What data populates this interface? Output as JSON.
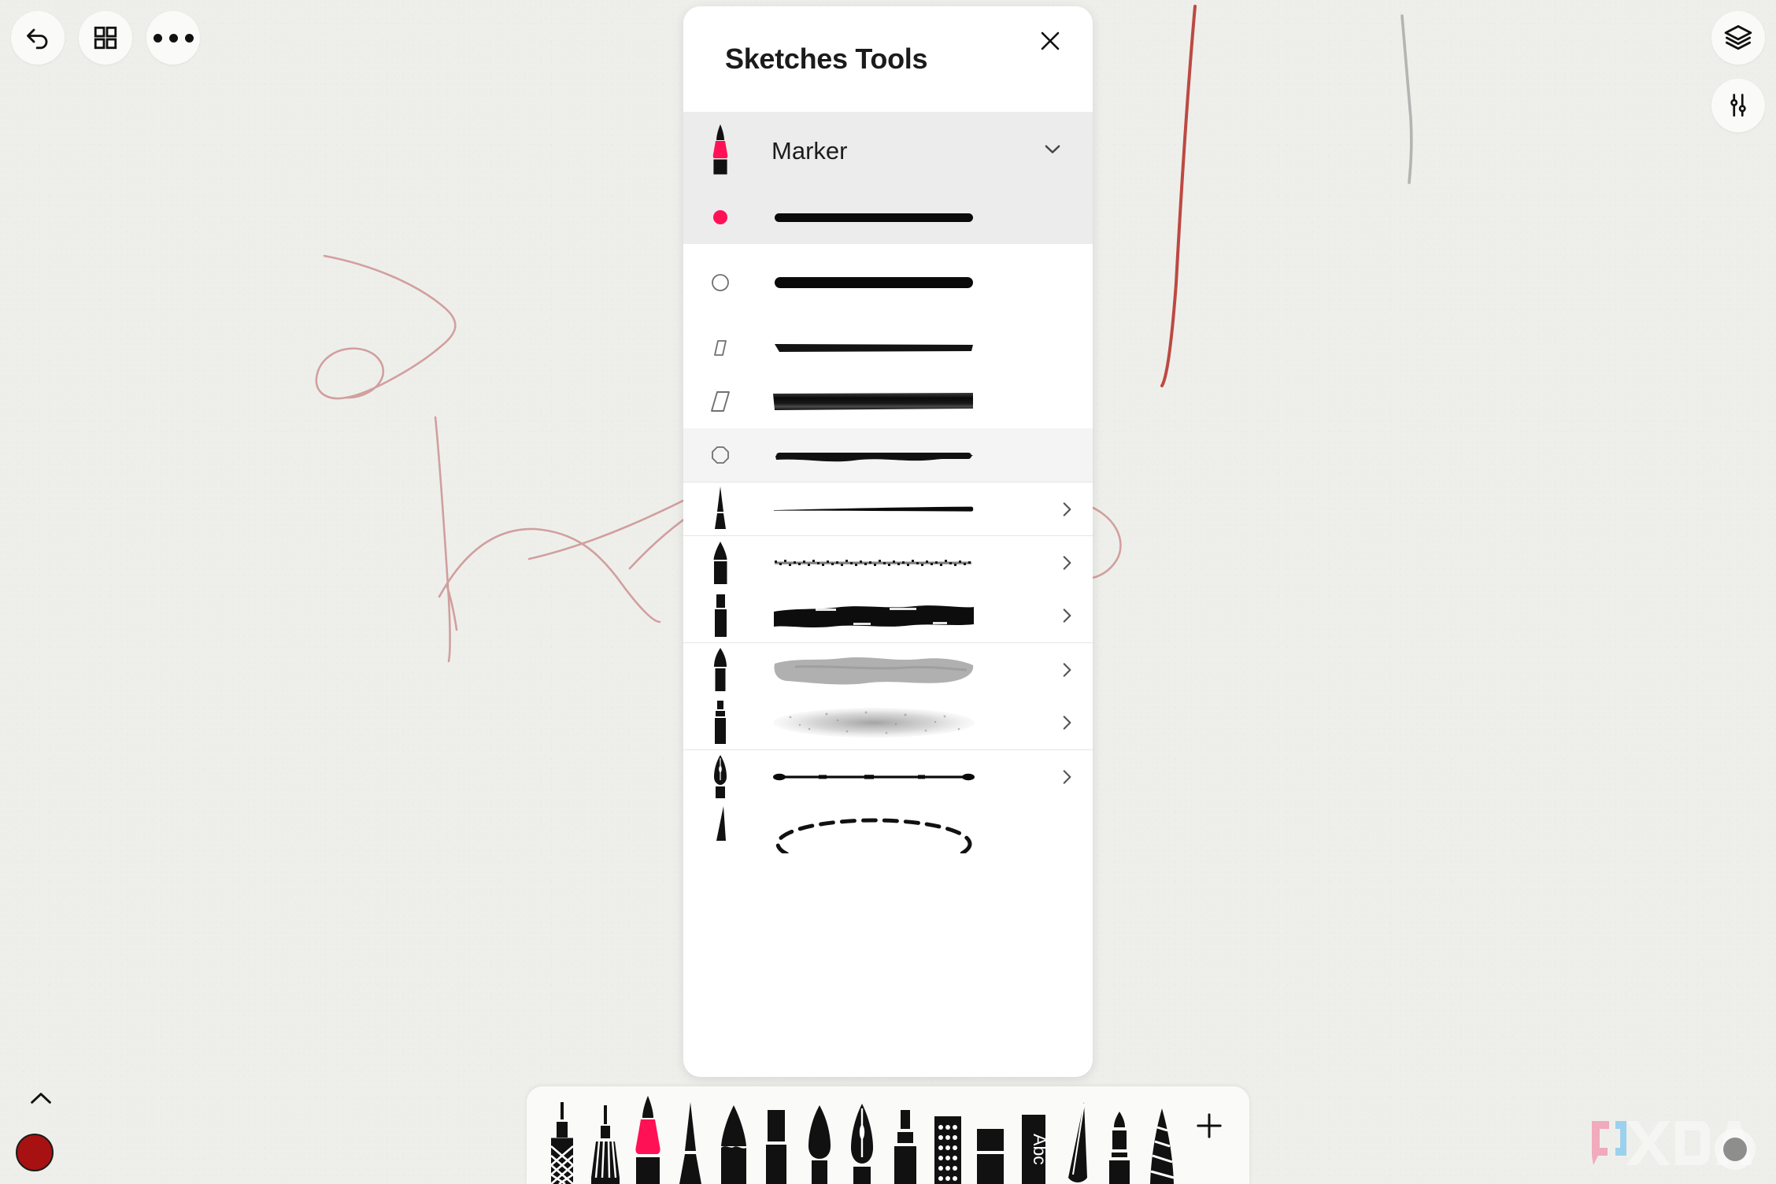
{
  "app": {
    "canvas_background": "#eeefeb",
    "accent_pink": "#ff1155",
    "color_swatch": "#a81111"
  },
  "top_left_toolbar": {
    "buttons": [
      {
        "name": "undo-button",
        "icon": "undo-arrow-icon"
      },
      {
        "name": "pages-button",
        "icon": "grid-squares-icon"
      },
      {
        "name": "more-button",
        "icon": "ellipsis-icon"
      }
    ]
  },
  "top_right_toolbar": {
    "buttons": [
      {
        "name": "layers-button",
        "icon": "layers-stack-icon"
      },
      {
        "name": "settings-button",
        "icon": "sliders-icon"
      }
    ]
  },
  "panel": {
    "title": "Sketches Tools",
    "close_icon": "close-icon",
    "selected_tool": {
      "label": "Marker",
      "icon": "marker-pen-icon",
      "chevron": "chevron-down-icon"
    },
    "brushes": [
      {
        "tip": "dot-filled-pink",
        "stroke": "solid-round-thick",
        "state": "selected",
        "has_chevron": false
      },
      {
        "tip": "circle-outline",
        "stroke": "solid-round-bold",
        "state": "normal",
        "has_chevron": false
      },
      {
        "tip": "small-parallelogram-outline",
        "stroke": "chisel-thin",
        "state": "normal",
        "has_chevron": false
      },
      {
        "tip": "large-parallelogram-outline",
        "stroke": "chisel-broad",
        "state": "normal",
        "has_chevron": false
      },
      {
        "tip": "octagon-outline",
        "stroke": "rough-marker",
        "state": "highlighted",
        "has_chevron": false
      },
      {
        "tip": "fine-liner-nib-icon",
        "stroke": "tapered-fine-line",
        "state": "normal",
        "has_chevron": true
      },
      {
        "tip": "pencil-tip-icon",
        "stroke": "grainy-pencil",
        "state": "normal",
        "has_chevron": true
      },
      {
        "tip": "flat-marker-tip-icon",
        "stroke": "dry-brush-heavy",
        "state": "normal",
        "has_chevron": true
      },
      {
        "tip": "round-brush-tip-icon",
        "stroke": "watercolor-wash",
        "state": "normal",
        "has_chevron": true
      },
      {
        "tip": "airbrush-tip-icon",
        "stroke": "spray-soft",
        "state": "normal",
        "has_chevron": true
      },
      {
        "tip": "fountain-nib-icon",
        "stroke": "ink-pen-line",
        "state": "normal",
        "has_chevron": true
      },
      {
        "tip": "blade-tip-icon",
        "stroke": "dashed-lasso",
        "state": "normal",
        "has_chevron": false
      }
    ]
  },
  "tool_strip": {
    "tools": [
      {
        "name": "tool-textured-pen",
        "icon": "crosshatch-pen-icon"
      },
      {
        "name": "tool-technical-pen",
        "icon": "striped-pen-icon"
      },
      {
        "name": "tool-marker",
        "icon": "marker-pen-icon",
        "active": true
      },
      {
        "name": "tool-fine-liner",
        "icon": "fine-liner-nib-icon"
      },
      {
        "name": "tool-pencil",
        "icon": "pencil-tip-icon"
      },
      {
        "name": "tool-flat-marker",
        "icon": "flat-marker-tip-icon"
      },
      {
        "name": "tool-brush",
        "icon": "round-brush-tip-icon"
      },
      {
        "name": "tool-fountain-pen",
        "icon": "fountain-nib-icon"
      },
      {
        "name": "tool-airbrush",
        "icon": "airbrush-tip-icon"
      },
      {
        "name": "tool-dotted-eraser",
        "icon": "dot-grid-eraser-icon"
      },
      {
        "name": "tool-eraser",
        "icon": "eraser-block-icon"
      },
      {
        "name": "tool-text",
        "icon": "abc-text-icon",
        "label": "Abc"
      },
      {
        "name": "tool-blade",
        "icon": "blade-tip-icon"
      },
      {
        "name": "tool-crayon",
        "icon": "crayon-tip-icon"
      },
      {
        "name": "tool-pastel",
        "icon": "striped-cone-icon"
      }
    ],
    "add_button": {
      "name": "add-tool-button",
      "icon": "plus-icon"
    }
  },
  "color_control": {
    "expand_icon": "chevron-up-icon",
    "swatch_color": "#a81111"
  },
  "watermark": {
    "text": "XDA"
  }
}
